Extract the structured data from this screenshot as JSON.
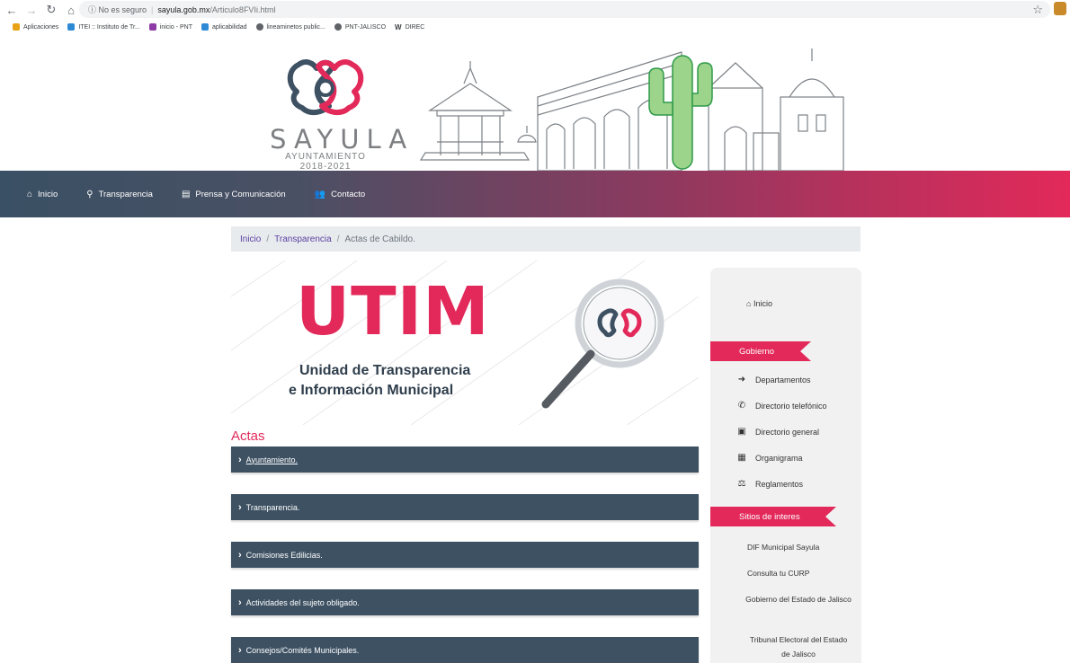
{
  "browser": {
    "security": "No es seguro",
    "host": "sayula.gob.mx",
    "path": "/Articulo8FVIi.html",
    "bookmarks": [
      {
        "label": "Aplicaciones",
        "icon": "apps-grid-icon",
        "color": "#e8a317"
      },
      {
        "label": "ITEI :: Instituto de Tr...",
        "icon": "itei-icon",
        "color": "#2f8ad6"
      },
      {
        "label": "inicio - PNT",
        "icon": "pnt-icon",
        "color": "#8e3ba8"
      },
      {
        "label": "aplicabilidad",
        "icon": "itei-icon",
        "color": "#2f8ad6"
      },
      {
        "label": "lineaminetos public...",
        "icon": "globe-icon",
        "color": "#5f6368"
      },
      {
        "label": "PNT-JALISCO",
        "icon": "globe-icon",
        "color": "#5f6368"
      },
      {
        "label": "DIREC",
        "icon": "w-icon",
        "color": "#333333"
      }
    ]
  },
  "header": {
    "brand": "SAYULA",
    "subtitle": "AYUNTAMIENTO 2018-2021",
    "accent": "#e2295a",
    "dark": "#3d5163"
  },
  "nav": [
    {
      "label": "Inicio",
      "icon": "home-icon"
    },
    {
      "label": "Transparencia",
      "icon": "search-icon"
    },
    {
      "label": "Prensa y Comunicación",
      "icon": "newspaper-icon"
    },
    {
      "label": "Contacto",
      "icon": "users-icon"
    }
  ],
  "breadcrumb": {
    "home": "Inicio",
    "section": "Transparencia",
    "current": "Actas de Cabildo."
  },
  "utim": {
    "word": "UTIM",
    "line1": "Unidad de Transparencia",
    "line2": "e Información Municipal"
  },
  "actas": {
    "title": "Actas",
    "items": [
      "Ayuntamiento.",
      "Transparencia.",
      "Comisiones Edilicias.",
      "Actividades del sujeto obligado.",
      "Consejos/Comités Municipales."
    ]
  },
  "sidebar": {
    "home": "Inicio",
    "gobierno_title": "Gobierno",
    "gobierno": [
      {
        "label": "Departamentos",
        "icon": "arrow-right-icon"
      },
      {
        "label": "Directorio telefónico",
        "icon": "phone-icon"
      },
      {
        "label": "Directorio general",
        "icon": "document-icon"
      },
      {
        "label": "Organigrama",
        "icon": "building-icon"
      },
      {
        "label": "Reglamentos",
        "icon": "scale-icon"
      }
    ],
    "sitios_title": "Sitios de interes",
    "sitios": [
      "DIF Municipal Sayula",
      "Consulta tu CURP",
      "Gobierno del Estado de Jalisco",
      "Tribunal Electoral del Estado de Jalisco"
    ]
  }
}
